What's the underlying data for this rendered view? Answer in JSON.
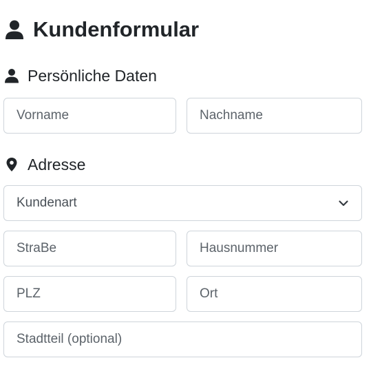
{
  "form": {
    "title": "Kundenformular",
    "title_icon": "user-icon"
  },
  "personal": {
    "heading": "Persönliche Daten",
    "icon": "user-icon",
    "firstname_placeholder": "Vorname",
    "firstname_value": "",
    "lastname_placeholder": "Nachname",
    "lastname_value": ""
  },
  "address": {
    "heading": "Adresse",
    "icon": "map-marker-icon",
    "customer_type": {
      "selected": "Kundenart",
      "icon": "chevron-down-icon"
    },
    "street_placeholder": "StraBe",
    "street_value": "",
    "housenumber_placeholder": "Hausnummer",
    "housenumber_value": "",
    "zip_placeholder": "PLZ",
    "zip_value": "",
    "city_placeholder": "Ort",
    "city_value": "",
    "district_placeholder": "Stadtteil (optional)",
    "district_value": ""
  },
  "colors": {
    "text": "#212529",
    "border": "#ced4da",
    "placeholder": "#5c636a"
  }
}
